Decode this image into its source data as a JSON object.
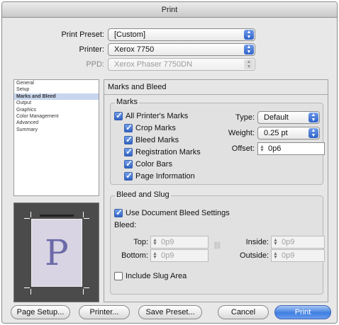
{
  "window": {
    "title": "Print"
  },
  "header": {
    "print_preset": {
      "label": "Print Preset:",
      "value": "[Custom]"
    },
    "printer": {
      "label": "Printer:",
      "value": "Xerox 7750"
    },
    "ppd": {
      "label": "PPD:",
      "value": "Xerox Phaser 7750DN"
    }
  },
  "sidebar": {
    "items": [
      {
        "label": "General"
      },
      {
        "label": "Setup"
      },
      {
        "label": "Marks and Bleed",
        "selected": true
      },
      {
        "label": "Output"
      },
      {
        "label": "Graphics"
      },
      {
        "label": "Color Management"
      },
      {
        "label": "Advanced"
      },
      {
        "label": "Summary"
      }
    ]
  },
  "preview": {
    "glyph": "P"
  },
  "panel": {
    "title": "Marks and Bleed",
    "marks": {
      "title": "Marks",
      "all_printers_marks": {
        "label": "All Printer's Marks",
        "checked": true
      },
      "crop_marks": {
        "label": "Crop Marks",
        "checked": true
      },
      "bleed_marks": {
        "label": "Bleed Marks",
        "checked": true
      },
      "registration_marks": {
        "label": "Registration Marks",
        "checked": true
      },
      "color_bars": {
        "label": "Color Bars",
        "checked": true
      },
      "page_information": {
        "label": "Page Information",
        "checked": true
      },
      "type": {
        "label": "Type:",
        "value": "Default"
      },
      "weight": {
        "label": "Weight:",
        "value": "0.25 pt"
      },
      "offset": {
        "label": "Offset:",
        "value": "0p6"
      }
    },
    "bleed_slug": {
      "title": "Bleed and Slug",
      "use_document": {
        "label": "Use Document Bleed Settings",
        "checked": true
      },
      "bleed_label": "Bleed:",
      "top": {
        "label": "Top:",
        "value": "0p9"
      },
      "bottom": {
        "label": "Bottom:",
        "value": "0p9"
      },
      "inside": {
        "label": "Inside:",
        "value": "0p9"
      },
      "outside": {
        "label": "Outside:",
        "value": "0p9"
      },
      "include_slug": {
        "label": "Include Slug Area",
        "checked": false
      }
    }
  },
  "footer": {
    "page_setup": "Page Setup...",
    "printer": "Printer...",
    "save_preset": "Save Preset...",
    "cancel": "Cancel",
    "print": "Print"
  },
  "colors": {
    "accent": "#3f7fe0",
    "selection": "#c7d6ee"
  }
}
